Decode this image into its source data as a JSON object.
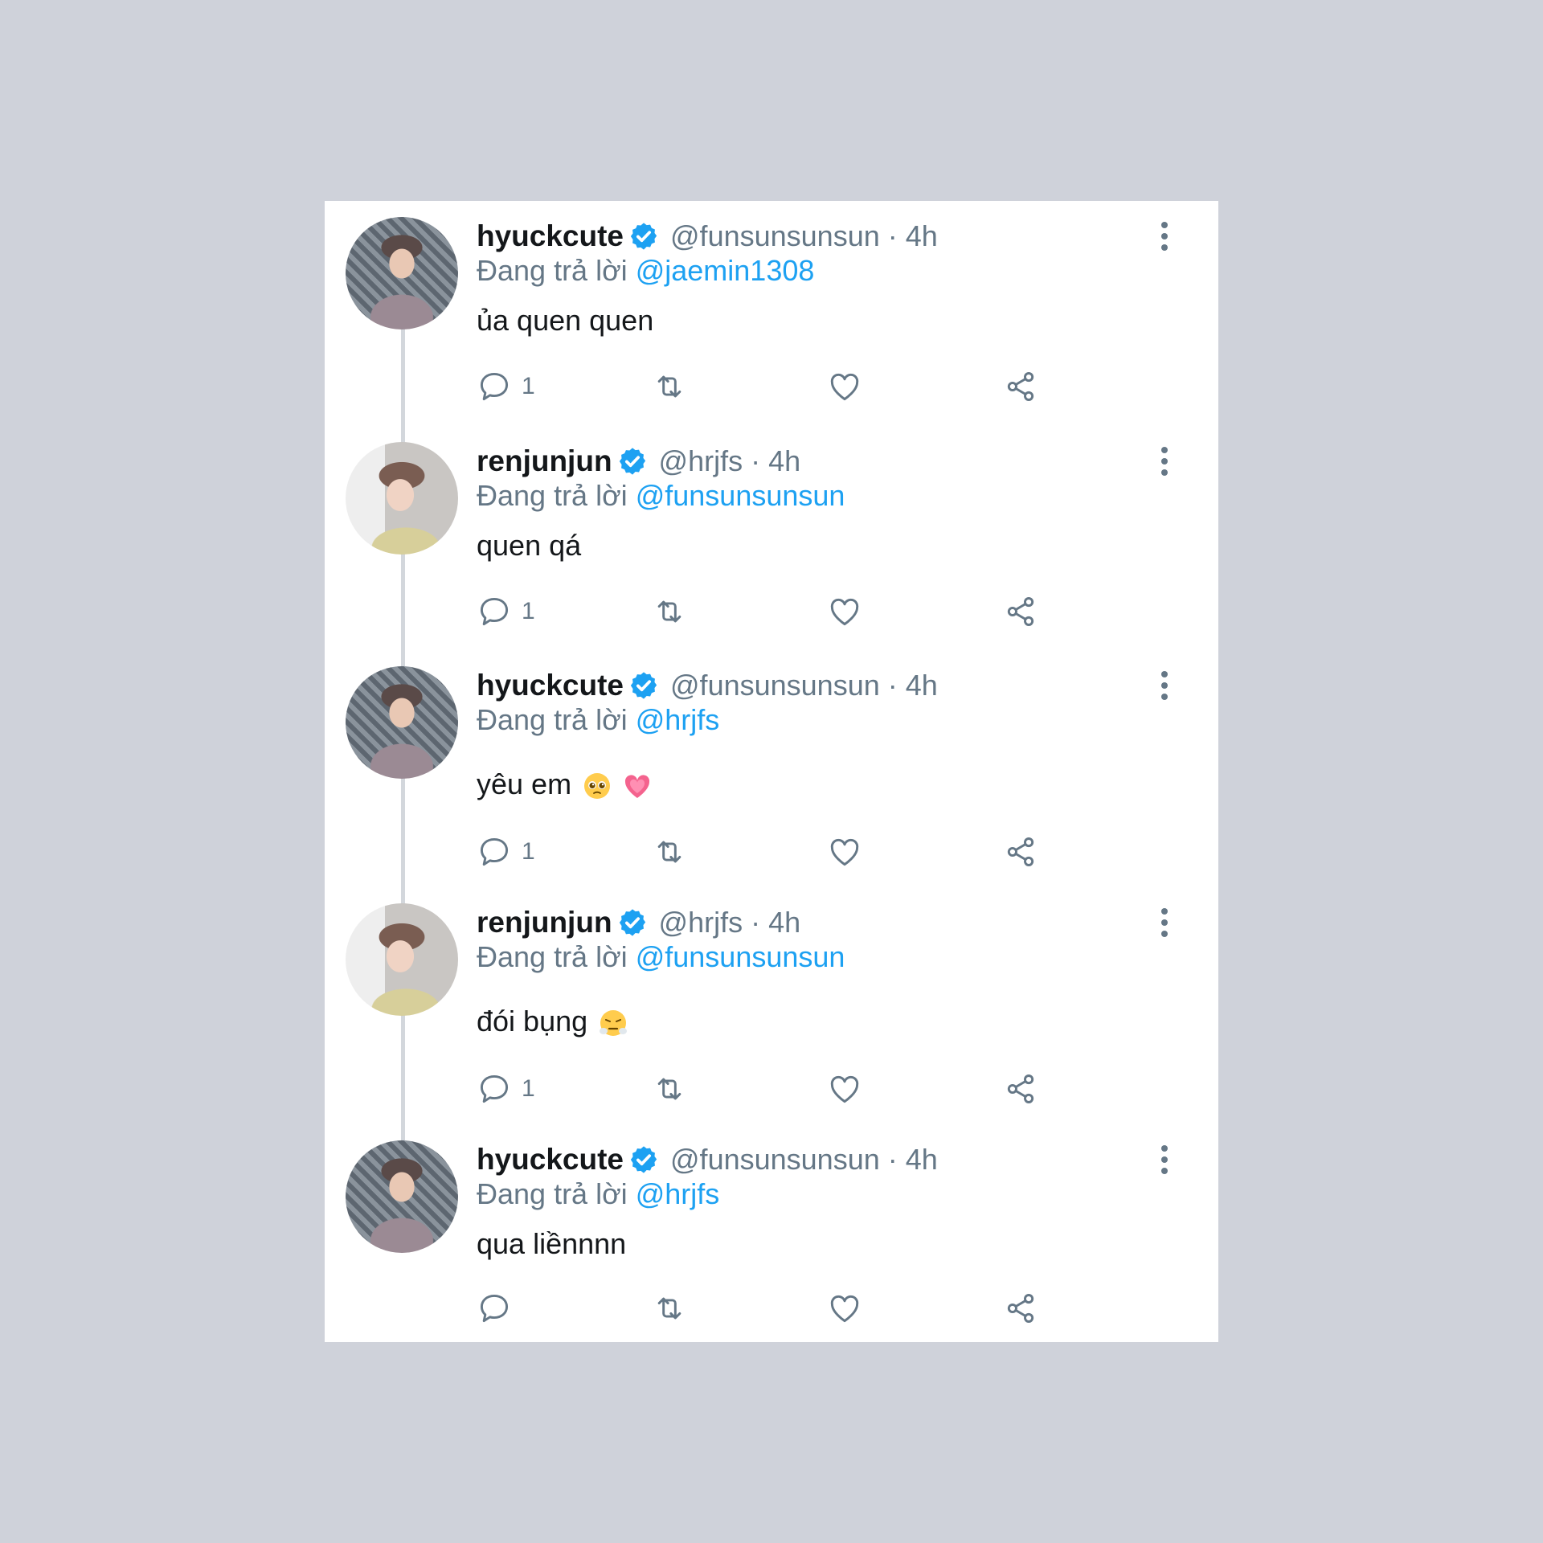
{
  "tweets": [
    {
      "name": "hyuckcute",
      "handle": "@funsunsunsun",
      "separator": "·",
      "time": "4h",
      "reply_prefix": "Đang trả lời",
      "reply_to": "@jaemin1308",
      "text": "ủa quen quen",
      "reply_count": "1",
      "avatar_icon": "avatar-hyuckcute"
    },
    {
      "name": "renjunjun",
      "handle": "@hrjfs",
      "separator": "·",
      "time": "4h",
      "reply_prefix": "Đang trả lời",
      "reply_to": "@funsunsunsun",
      "text": "quen qá",
      "reply_count": "1",
      "avatar_icon": "avatar-renjunjun"
    },
    {
      "name": "hyuckcute",
      "handle": "@funsunsunsun",
      "separator": "·",
      "time": "4h",
      "reply_prefix": "Đang trả lời",
      "reply_to": "@hrjfs",
      "text": "yêu em",
      "reply_count": "1",
      "emoji_icons": [
        "pleading-face-emoji",
        "growing-heart-emoji"
      ],
      "avatar_icon": "avatar-hyuckcute"
    },
    {
      "name": "renjunjun",
      "handle": "@hrjfs",
      "separator": "·",
      "time": "4h",
      "reply_prefix": "Đang trả lời",
      "reply_to": "@funsunsunsun",
      "text": "đói bụng",
      "reply_count": "1",
      "emoji_icons": [
        "face-with-steam-emoji"
      ],
      "avatar_icon": "avatar-renjunjun"
    },
    {
      "name": "hyuckcute",
      "handle": "@funsunsunsun",
      "separator": "·",
      "time": "4h",
      "reply_prefix": "Đang trả lời",
      "reply_to": "@hrjfs",
      "text": "qua liềnnnn",
      "reply_count": "",
      "avatar_icon": "avatar-hyuckcute"
    }
  ],
  "colors": {
    "background": "#cfd2da",
    "card": "#ffffff",
    "name_text": "#14171a",
    "muted_text": "#657786",
    "link": "#1da1f2",
    "verified_badge": "#1da1f2",
    "thread_line": "#d3d7dc"
  },
  "icons": {
    "verified": "verified-badge-icon",
    "more": "more-vertical-icon",
    "reply": "reply-bubble-icon",
    "retweet": "retweet-icon",
    "like": "heart-icon",
    "share": "share-icon"
  }
}
